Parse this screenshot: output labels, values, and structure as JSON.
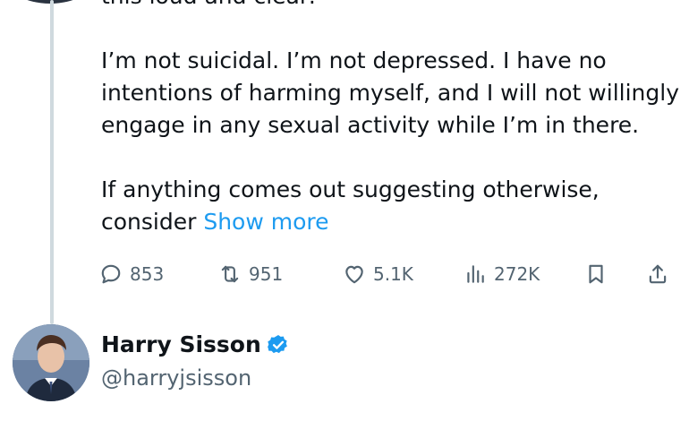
{
  "tweet": {
    "lines": [
      "this loud and clear:",
      "I’m not suicidal. I’m not depressed. I have no",
      "intentions of harming myself, and I will not willingly",
      "engage in any sexual activity while I’m in there.",
      "If anything comes out suggesting otherwise,",
      "consider"
    ],
    "show_more": "Show more"
  },
  "actions": {
    "replies": "853",
    "reposts": "951",
    "likes": "5.1K",
    "views": "272K"
  },
  "author": {
    "name": "Harry Sisson",
    "handle": "@harryjsisson",
    "verified_color": "#1d9bf0"
  },
  "icons": {
    "reply": "reply-icon",
    "repost": "repost-icon",
    "like": "heart-icon",
    "views": "analytics-icon",
    "bookmark": "bookmark-icon",
    "share": "share-icon",
    "verified": "verified-badge-icon"
  }
}
